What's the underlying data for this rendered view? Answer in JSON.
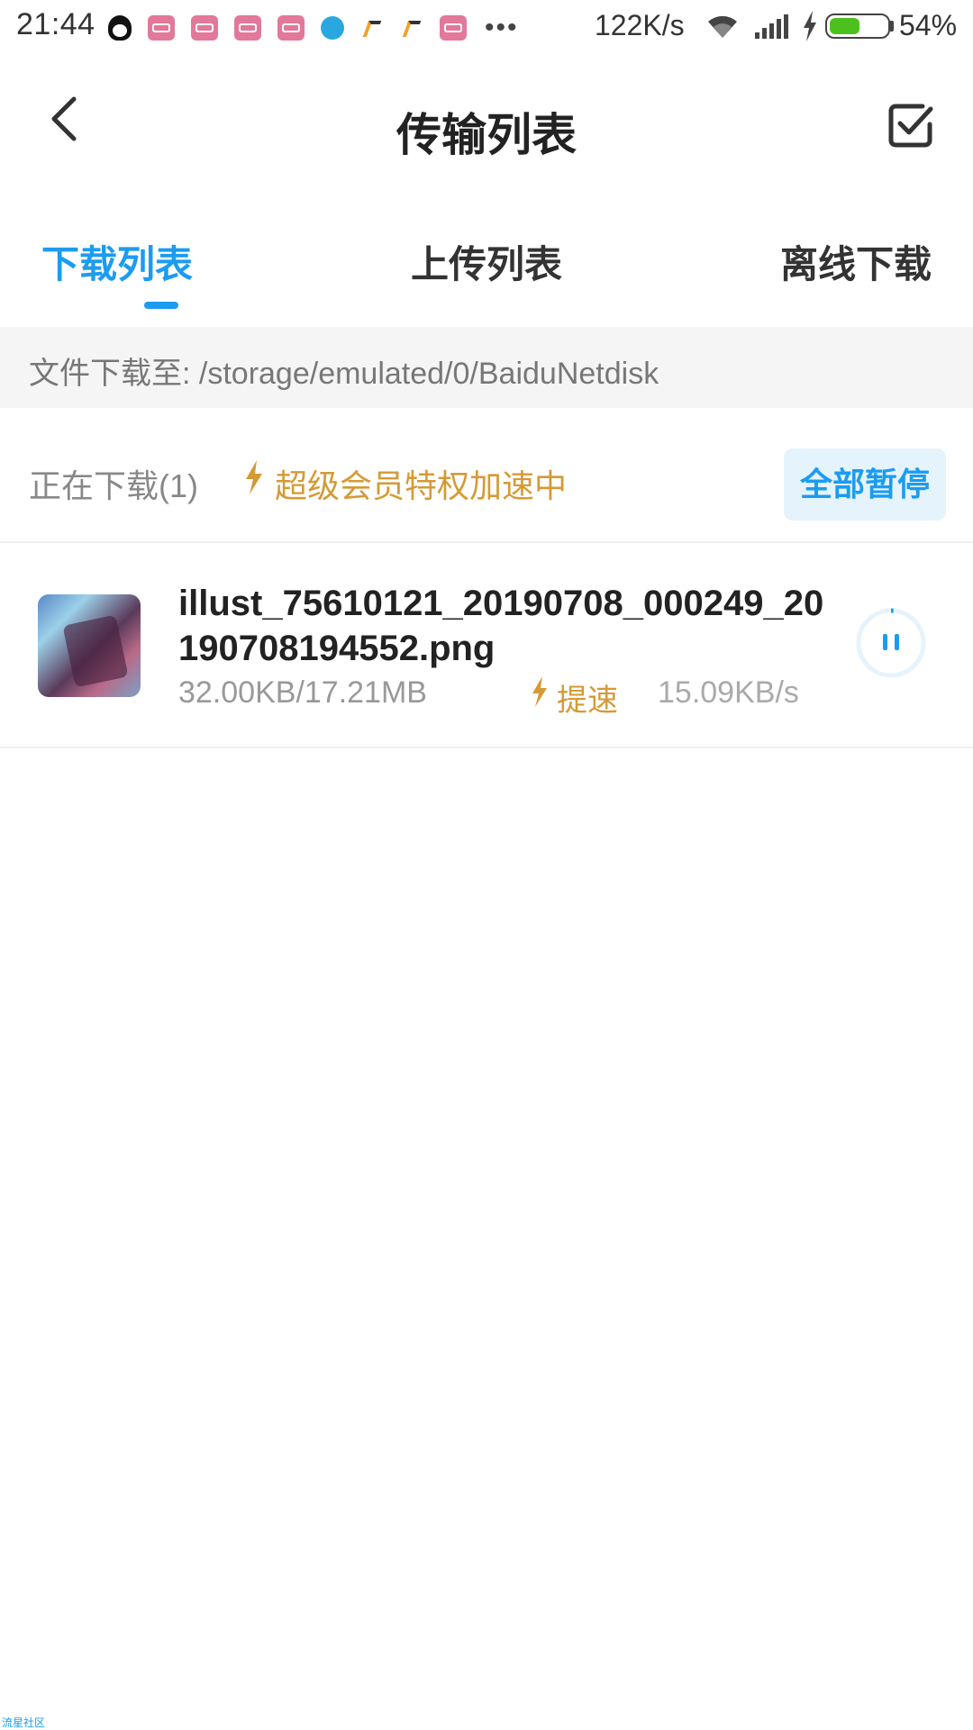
{
  "status_bar": {
    "time": "21:44",
    "net_speed": "122K/s",
    "battery_percent": "54%",
    "battery_level": 0.54,
    "more_indicator": "•••",
    "notification_icons": [
      "qq-icon",
      "bilibili-icon",
      "bilibili-icon",
      "bilibili-icon",
      "bilibili-icon",
      "browser-icon",
      "app-arrow-icon",
      "app-arrow-icon",
      "bilibili-icon"
    ]
  },
  "header": {
    "title": "传输列表",
    "back_icon": "chevron-left-icon",
    "select_icon": "checkbox-icon"
  },
  "tabs": [
    {
      "label": "下载列表",
      "active": true
    },
    {
      "label": "上传列表",
      "active": false
    },
    {
      "label": "离线下载",
      "active": false
    }
  ],
  "path_bar": {
    "text": "文件下载至: /storage/emulated/0/BaiduNetdisk"
  },
  "section": {
    "count_label": "正在下载(1)",
    "vip_label": "超级会员特权加速中",
    "pause_all_label": "全部暂停"
  },
  "downloads": [
    {
      "file_name": "illust_75610121_20190708_000249_20190708194552.png",
      "size_progress": "32.00KB/17.21MB",
      "speedup_label": "提速",
      "speed": "15.09KB/s",
      "progress": 0.0018
    }
  ],
  "watermark": "流星社区",
  "colors": {
    "accent": "#1b9cf0",
    "vip_gold": "#d59a35",
    "battery_green": "#4cc11e"
  }
}
